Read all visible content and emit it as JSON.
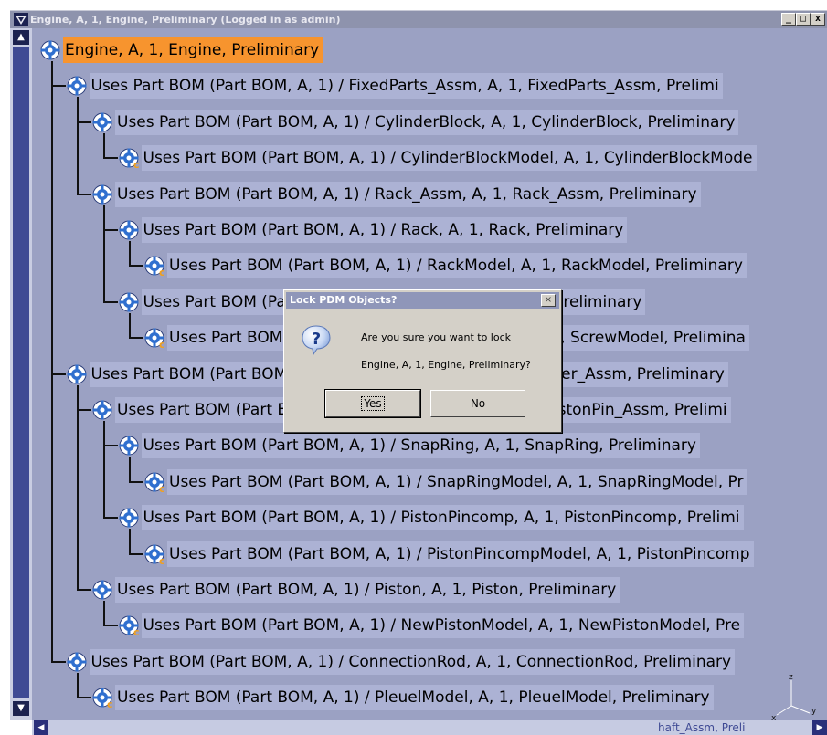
{
  "window": {
    "title": "Engine, A, 1, Engine, Preliminary (Logged in as admin)",
    "minimize_label": "_",
    "maximize_label": "□",
    "close_label": "x"
  },
  "tree": {
    "nodes": [
      {
        "label": "Engine, A, 1, Engine, Preliminary",
        "type": "product",
        "depth": 0,
        "state": "root"
      },
      {
        "label": "Uses Part BOM (Part BOM, A, 1) / FixedParts_Assm, A, 1, FixedParts_Assm, Prelimi",
        "type": "product",
        "depth": 1,
        "state": "selected"
      },
      {
        "label": "Uses Part BOM (Part BOM, A, 1) / CylinderBlock, A, 1, CylinderBlock, Preliminary",
        "type": "product",
        "depth": 2,
        "state": "selected"
      },
      {
        "label": "Uses Part BOM (Part BOM, A, 1) / CylinderBlockModel, A, 1, CylinderBlockMode",
        "type": "model",
        "depth": 3,
        "state": "selected"
      },
      {
        "label": "Uses Part BOM (Part BOM, A, 1) / Rack_Assm, A, 1, Rack_Assm, Preliminary",
        "type": "product",
        "depth": 2,
        "state": "selected"
      },
      {
        "label": "Uses Part BOM (Part BOM, A, 1) / Rack, A, 1, Rack, Preliminary",
        "type": "product",
        "depth": 3,
        "state": "selected"
      },
      {
        "label": "Uses Part BOM (Part BOM, A, 1) / RackModel, A, 1, RackModel, Preliminary",
        "type": "model",
        "depth": 4,
        "state": "selected"
      },
      {
        "label": "Uses Part BOM (Part BOM, A, 1) / Screw, A, 1, Screw, Preliminary",
        "type": "product",
        "depth": 3,
        "state": "selected"
      },
      {
        "label": "Uses Part BOM (Part BOM, A, 1) / ScrewModel, A, 1, ScrewModel, Prelimina",
        "type": "model",
        "depth": 4,
        "state": "selected"
      },
      {
        "label": "Uses Part BOM (Part BOM, A, 1) / Cylinder_Assm, A, 1, Cylinder_Assm, Preliminary",
        "type": "product",
        "depth": 1,
        "state": "selected"
      },
      {
        "label": "Uses Part BOM (Part BOM, A, 1) / PistonPin_Assm, A, 1, PistonPin_Assm, Prelimi",
        "type": "product",
        "depth": 2,
        "state": "selected"
      },
      {
        "label": "Uses Part BOM (Part BOM, A, 1) / SnapRing, A, 1, SnapRing, Preliminary",
        "type": "product",
        "depth": 3,
        "state": "selected"
      },
      {
        "label": "Uses Part BOM (Part BOM, A, 1) / SnapRingModel, A, 1, SnapRingModel, Pr",
        "type": "model",
        "depth": 4,
        "state": "selected"
      },
      {
        "label": "Uses Part BOM (Part BOM, A, 1) / PistonPincomp, A, 1, PistonPincomp, Prelimi",
        "type": "product",
        "depth": 3,
        "state": "selected"
      },
      {
        "label": "Uses Part BOM (Part BOM, A, 1) / PistonPincompModel, A, 1, PistonPincomp",
        "type": "model",
        "depth": 4,
        "state": "selected"
      },
      {
        "label": "Uses Part BOM (Part BOM, A, 1) / Piston, A, 1, Piston, Preliminary",
        "type": "product",
        "depth": 2,
        "state": "selected"
      },
      {
        "label": "Uses Part BOM (Part BOM, A, 1) / NewPistonModel, A, 1, NewPistonModel, Pre",
        "type": "model",
        "depth": 3,
        "state": "selected"
      },
      {
        "label": "Uses Part BOM (Part BOM, A, 1) / ConnectionRod, A, 1, ConnectionRod, Preliminary",
        "type": "product",
        "depth": 1,
        "state": "selected"
      },
      {
        "label": "Uses Part BOM (Part BOM, A, 1) / PleuelModel, A, 1, PleuelModel, Preliminary",
        "type": "model",
        "depth": 2,
        "state": "selected"
      }
    ],
    "bottom_partial_label": "haft_Assm, Preli"
  },
  "axis": {
    "z_label": "z",
    "y_label": "y",
    "x_label": "x"
  },
  "dialog": {
    "title": "Lock PDM Objects?",
    "close_label": "×",
    "icon": "question-icon",
    "message_line1": "Are you sure you want to lock",
    "message_line2": "Engine, A, 1, Engine, Preliminary?",
    "yes_label": "Yes",
    "no_label": "No"
  },
  "colors": {
    "tree_background": "#9ba1c3",
    "root_highlight": "#f7942e",
    "selection": "#acb2d4",
    "dialog_background": "#d4d0c8"
  }
}
